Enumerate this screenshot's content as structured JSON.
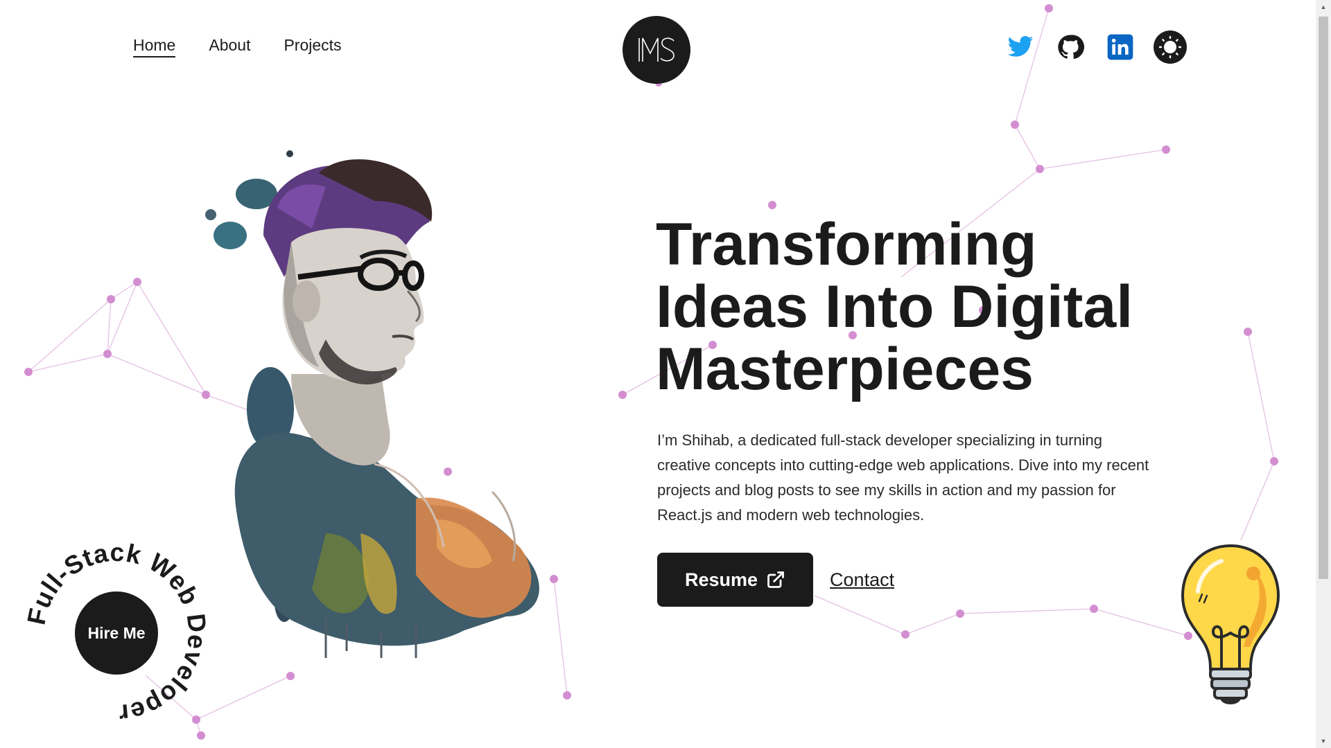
{
  "nav": {
    "items": [
      {
        "label": "Home",
        "active": true
      },
      {
        "label": "About",
        "active": false
      },
      {
        "label": "Projects",
        "active": false
      }
    ]
  },
  "logo": {
    "text": "MS"
  },
  "socials": [
    {
      "icon": "twitter-icon",
      "color": "#1da1f2"
    },
    {
      "icon": "github-icon",
      "color": "#1b1b1b"
    },
    {
      "icon": "linkedin-icon",
      "color": "#0a66c2"
    }
  ],
  "theme_toggle": {
    "icon": "sun-icon"
  },
  "hero": {
    "headline": "Transforming Ideas Into Digital Masterpieces",
    "intro": "I’m Shihab, a dedicated full-stack developer specializing in turning creative concepts into cutting-edge web applications. Dive into my recent projects and blog posts to see my skills in action and my passion for React.js and modern web technologies.",
    "resume_label": "Resume",
    "contact_label": "Contact"
  },
  "badge": {
    "ring_text": "Full-Stack Web Developer",
    "hire_label": "Hire Me"
  },
  "colors": {
    "dark": "#1b1b1b",
    "particle": "#d38ed1",
    "particle_line": "#e7c3e6",
    "bulb": "#ffd84a"
  }
}
